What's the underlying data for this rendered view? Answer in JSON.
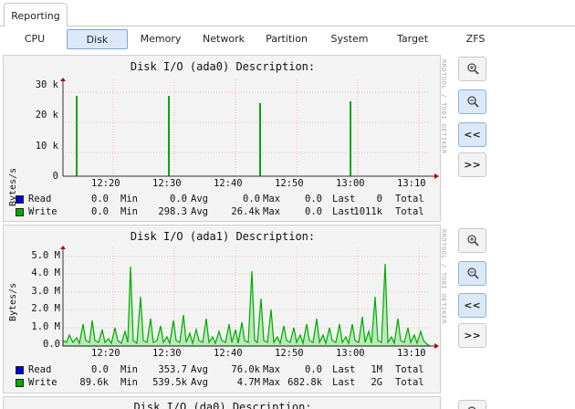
{
  "main_tabs": [
    {
      "label": "Reporting",
      "active": true
    }
  ],
  "sub_tabs": [
    {
      "label": "CPU",
      "active": false
    },
    {
      "label": "Disk",
      "active": true
    },
    {
      "label": "Memory",
      "active": false
    },
    {
      "label": "Network",
      "active": false
    },
    {
      "label": "Partition",
      "active": false
    },
    {
      "label": "System",
      "active": false
    },
    {
      "label": "Target",
      "active": false
    },
    {
      "label": "ZFS",
      "active": false
    }
  ],
  "graphs": [
    {
      "title": "Disk I/O (ada0) Description:",
      "ylabel": "Bytes/s",
      "watermark": "RRDTOOL / TOBI OETIKER",
      "yticks": [
        "30 k",
        "20 k",
        "10 k",
        "0"
      ],
      "xticks": [
        "12:20",
        "12:30",
        "12:40",
        "12:50",
        "13:00",
        "13:10"
      ],
      "legend": [
        {
          "name": "Read",
          "cur": "0.0",
          "min": "0.0",
          "avg": "0.0",
          "max": "0.0",
          "last": "0",
          "total_label": "Total"
        },
        {
          "name": "Write",
          "cur": "0.0",
          "min": "298.3",
          "avg": "26.4k",
          "max": "0.0",
          "last": "1011k",
          "total_label": "Total"
        }
      ],
      "labels": {
        "min": "Min",
        "avg": "Avg",
        "max": "Max",
        "last": "Last"
      }
    },
    {
      "title": "Disk I/O (ada1) Description:",
      "ylabel": "Bytes/s",
      "watermark": "RRDTOOL / TOBI OETIKER",
      "yticks": [
        "5.0 M",
        "4.0 M",
        "3.0 M",
        "2.0 M",
        "1.0 M",
        "0.0"
      ],
      "xticks": [
        "12:20",
        "12:30",
        "12:40",
        "12:50",
        "13:00",
        "13:10"
      ],
      "legend": [
        {
          "name": "Read",
          "cur": "0.0",
          "min": "353.7",
          "avg": "76.0k",
          "max": "0.0",
          "last": "1M",
          "total_label": "Total"
        },
        {
          "name": "Write",
          "cur": "89.6k",
          "min": "539.5k",
          "avg": "4.7M",
          "max": "682.8k",
          "last": "2G",
          "total_label": "Total"
        }
      ],
      "labels": {
        "min": "Min",
        "avg": "Avg",
        "max": "Max",
        "last": "Last"
      }
    },
    {
      "title": "Disk I/O (da0) Description:"
    }
  ],
  "colors": {
    "read": "#0000dd",
    "write": "#00aa00",
    "grid_major": "#e88",
    "grid_minor": "#f3c0c0",
    "active_tab": "#dbe9fb"
  },
  "controls_icons": [
    "zoom-in-icon",
    "zoom-out-icon",
    "double-left-icon",
    "double-right-icon"
  ],
  "controls_labels": {
    "back": "<<",
    "forward": ">>"
  }
}
